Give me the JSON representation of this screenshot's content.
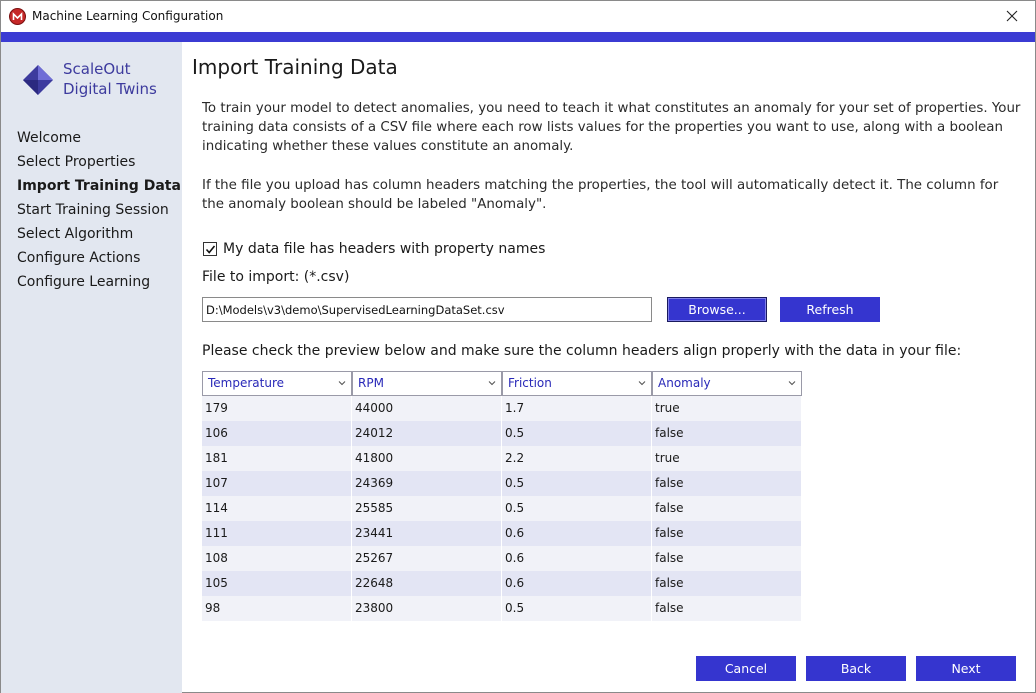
{
  "window": {
    "title": "Machine Learning Configuration"
  },
  "logo": {
    "line1": "ScaleOut",
    "line2": "Digital Twins"
  },
  "sidebar": {
    "items": [
      {
        "label": "Welcome",
        "active": false
      },
      {
        "label": "Select Properties",
        "active": false
      },
      {
        "label": "Import Training Data",
        "active": true
      },
      {
        "label": "Start Training Session",
        "active": false
      },
      {
        "label": "Select Algorithm",
        "active": false
      },
      {
        "label": "Configure Actions",
        "active": false
      },
      {
        "label": "Configure Learning",
        "active": false
      }
    ]
  },
  "main": {
    "title": "Import Training Data",
    "para1": "To train your model to detect anomalies, you need to teach it what constitutes an anomaly for your set of properties. Your training data consists of a CSV file where each row lists values for the properties you want to use, along with a boolean indicating whether these values constitute an anomaly.",
    "para2": "If the file you upload has column headers matching the properties, the tool will automatically detect it. The column for the anomaly boolean should be labeled \"Anomaly\".",
    "headers_checkbox_label": "My data file has headers with property names",
    "headers_checkbox_checked": true,
    "file_label": "File to import: (*.csv)",
    "file_path": "D:\\Models\\v3\\demo\\SupervisedLearningDataSet.csv",
    "browse_label": "Browse...",
    "refresh_label": "Refresh",
    "preview_label": "Please check the preview below and make sure the column headers align properly with the data in your file:"
  },
  "preview": {
    "columns": [
      "Temperature",
      "RPM",
      "Friction",
      "Anomaly"
    ],
    "rows": [
      [
        "179",
        "44000",
        "1.7",
        "true"
      ],
      [
        "106",
        "24012",
        "0.5",
        "false"
      ],
      [
        "181",
        "41800",
        "2.2",
        "true"
      ],
      [
        "107",
        "24369",
        "0.5",
        "false"
      ],
      [
        "114",
        "25585",
        "0.5",
        "false"
      ],
      [
        "111",
        "23441",
        "0.6",
        "false"
      ],
      [
        "108",
        "25267",
        "0.6",
        "false"
      ],
      [
        "105",
        "22648",
        "0.6",
        "false"
      ],
      [
        "98",
        "23800",
        "0.5",
        "false"
      ]
    ]
  },
  "footer": {
    "cancel_label": "Cancel",
    "back_label": "Back",
    "next_label": "Next"
  },
  "colors": {
    "accent": "#3b3bd3",
    "button": "#3535cf",
    "sidebar_bg": "#e2e7f0",
    "header_text": "#2929b8"
  },
  "icons": {
    "app": "app-logo-icon",
    "close": "close-icon",
    "dropdown": "chevron-down-icon",
    "check": "checkmark-icon"
  }
}
